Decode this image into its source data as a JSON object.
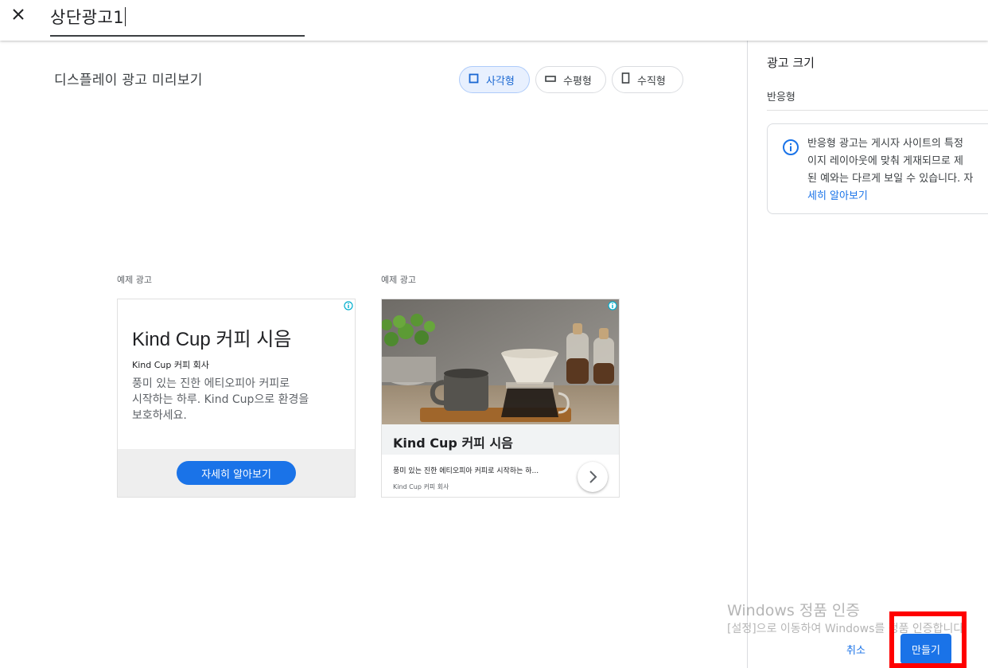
{
  "header": {
    "title_value": "상단광고1",
    "close_icon": "close-icon"
  },
  "preview": {
    "title": "디스플레이 광고 미리보기",
    "toggles": [
      {
        "label": "사각형",
        "icon": "square-icon",
        "active": true
      },
      {
        "label": "수평형",
        "icon": "horizontal-rect-icon",
        "active": false
      },
      {
        "label": "수직형",
        "icon": "vertical-rect-icon",
        "active": false
      }
    ]
  },
  "ads": {
    "label_1": "예제 광고",
    "label_2": "예제 광고",
    "ad1": {
      "headline": "Kind Cup 커피 시음",
      "advertiser": "Kind Cup 커피 회사",
      "description_line1": "풍미 있는 진한 에티오피아 커피로",
      "description_line2": "시작하는 하루. Kind Cup으로 환경을",
      "description_line3": "보호하세요.",
      "cta": "자세히 알아보기"
    },
    "ad2": {
      "headline": "Kind Cup 커피 시음",
      "description": "풍미 있는 진한 에티오피아 커피로 시작하는 하...",
      "advertiser": "Kind Cup 커피 회사",
      "next_icon": "chevron-right-icon"
    }
  },
  "panel": {
    "title": "광고 크기",
    "size_type": "반응형",
    "info_line1": "반응형 광고는 게시자 사이트의 특정",
    "info_line2": "이지 레이아웃에 맞춰 게재되므로 제",
    "info_line3": "된 예와는 다르게 보일 수 있습니다. 자",
    "info_link": "세히 알아보기"
  },
  "actions": {
    "cancel": "취소",
    "create": "만들기"
  },
  "watermark": {
    "line1": "Windows 정품 인증",
    "line2": "[설정]으로 이동하여 Windows를 정품 인증합니다."
  },
  "colors": {
    "accent": "#1a73e8",
    "highlight": "#ff0000"
  }
}
